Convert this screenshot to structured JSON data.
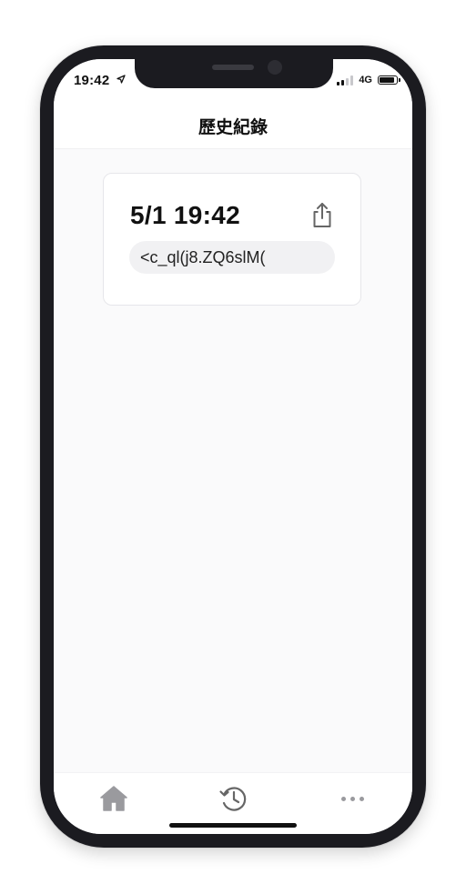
{
  "status_bar": {
    "time": "19:42",
    "network": "4G",
    "signal_bars_active": 2,
    "battery_level": 0.9
  },
  "header": {
    "title": "歷史紀錄"
  },
  "history": {
    "items": [
      {
        "datetime": "5/1 19:42",
        "code": "<c_ql(j8.ZQ6slM("
      }
    ]
  },
  "tab_bar": {
    "tabs": [
      {
        "icon": "home-icon"
      },
      {
        "icon": "history-icon"
      },
      {
        "icon": "more-icon"
      }
    ]
  },
  "colors": {
    "frame": "#1b1b20",
    "background": "#fafafb",
    "card_border": "#e6e6ea",
    "pill_background": "#f1f1f3",
    "tab_icon": "#9a9a9e",
    "text": "#111111"
  }
}
